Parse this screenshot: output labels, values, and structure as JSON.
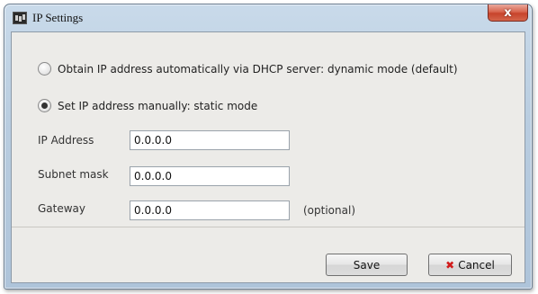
{
  "window": {
    "title": "IP Settings",
    "close_glyph": "x"
  },
  "options": {
    "dhcp_label": "Obtain IP address automatically via DHCP server: dynamic mode (default)",
    "static_label": "Set IP address manually: static mode",
    "selected": "static"
  },
  "fields": {
    "ip_label": "IP Address",
    "ip_value": "0.0.0.0",
    "subnet_label": "Subnet mask",
    "subnet_value": "0.0.0.0",
    "gateway_label": "Gateway",
    "gateway_value": "0.0.0.0",
    "gateway_note": "(optional)"
  },
  "buttons": {
    "save_label": "Save",
    "cancel_label": "Cancel",
    "cancel_icon_glyph": "✖"
  },
  "icons": {
    "app": "app-icon",
    "close": "close-icon",
    "cancel": "x-icon"
  },
  "colors": {
    "cancel_icon": "#d11a1a",
    "close_button": "#c7432b"
  }
}
